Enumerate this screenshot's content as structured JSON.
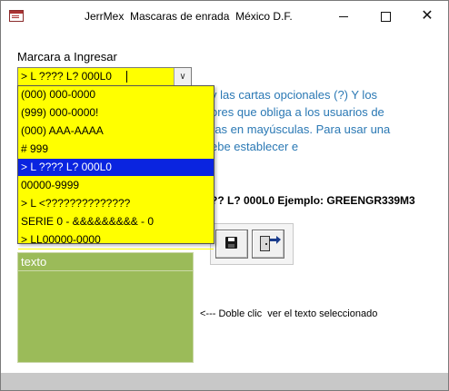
{
  "window": {
    "title": "JerrMex  Mascaras de enrada  México D.F.",
    "minimize_glyph": "",
    "close_glyph": "✕"
  },
  "form": {
    "field_label": "Marcara a Ingresar",
    "combo_value": "> L ???? L? 000L0",
    "dropdown_items": [
      "(000) 000-0000",
      "(999) 000-0000!",
      "(000) AAA-AAAA",
      "# 999",
      "> L ???? L? 000L0",
      "00000-9999",
      "> L <??????????????",
      "SERIE 0 - &&&&&&&&& - 0",
      "> LL00000-0000"
    ],
    "selected_index": 4,
    "info_lines": [
      "y las cartas opcionales (?) Y los",
      "ores que obliga a los usuarios de",
      "ras en mayúsculas. Para usar una",
      "ebe establecer e"
    ],
    "example_text": "?? L? 000L0 Ejemplo: GREENGR339M3",
    "textbox_label": "texto",
    "hint_text": "<--- Doble clic  ver el texto seleccionado"
  },
  "icons": {
    "app": "access-form-icon",
    "save": "floppy-disk-icon",
    "exit": "exit-door-icon",
    "dropdown": "chevron-down-icon"
  },
  "colors": {
    "combo_background": "#ffff00",
    "selected_item": "#0a24e0",
    "info_text": "#2a78b4",
    "textbox_background": "#9bbb59"
  }
}
